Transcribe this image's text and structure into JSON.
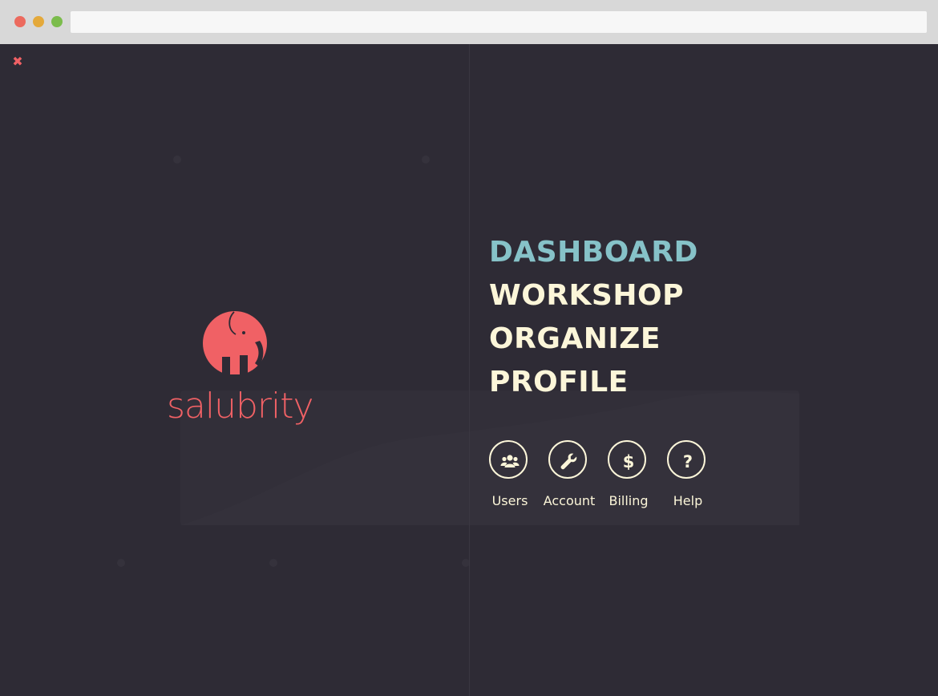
{
  "browser": {
    "traffic_lights": [
      "#ec6a5e",
      "#e4a93b",
      "#7bbc4c"
    ]
  },
  "menu": {
    "close_glyph": "✖",
    "brand": {
      "name": "salubrity",
      "logo_icon": "elephant-icon",
      "color": "#f06165"
    },
    "nav_items": [
      {
        "label": "DASHBOARD",
        "active": true
      },
      {
        "label": "WORKSHOP",
        "active": false
      },
      {
        "label": "ORGANIZE",
        "active": false
      },
      {
        "label": "PROFILE",
        "active": false
      }
    ],
    "shortcuts": [
      {
        "label": "Users",
        "icon": "users-icon"
      },
      {
        "label": "Account",
        "icon": "wrench-icon"
      },
      {
        "label": "Billing",
        "icon": "dollar-icon"
      },
      {
        "label": "Help",
        "icon": "question-icon"
      }
    ],
    "colors": {
      "background": "#2e2b35",
      "text": "#fcf6d9",
      "active": "#86c2c8"
    }
  }
}
